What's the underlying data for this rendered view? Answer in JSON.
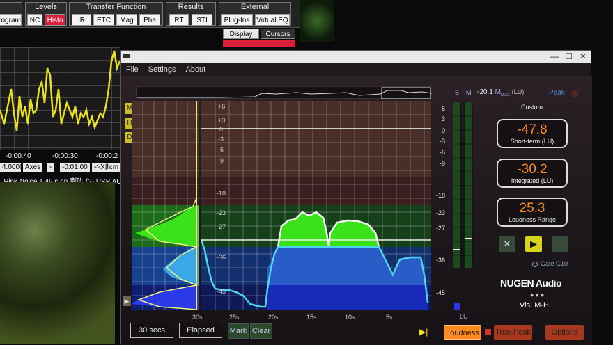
{
  "background_app": {
    "toolbar_groups": [
      {
        "title": "",
        "buttons": [
          "rogram"
        ]
      },
      {
        "title": "Levels",
        "buttons": [
          "NC",
          "Histo"
        ]
      },
      {
        "title": "Transfer Function",
        "buttons": [
          "IR",
          "ETC",
          "Mag",
          "Pha"
        ]
      },
      {
        "title": "Results",
        "buttons": [
          "RT",
          "STI"
        ]
      },
      {
        "title": "External",
        "buttons": [
          "Plug-Ins",
          "Virtual EQ"
        ]
      }
    ],
    "active_button": "Histo",
    "tabs": [
      "Display",
      "Cursors"
    ],
    "time_ticks": [
      "-0:00:40",
      "-0:00:30",
      "-0:00:2"
    ],
    "controls": [
      "4.0000",
      "Axes",
      "-",
      "-0:01:00",
      "<-X|h:m"
    ],
    "status": ": Pink Noise   1.49 s on 喇叭 (2- USB AUD"
  },
  "app": {
    "title_controls": {
      "minimize": "—",
      "maximize": "☐",
      "close": "✕"
    },
    "menu": [
      "File",
      "Settings",
      "About"
    ],
    "side_buttons": [
      "M",
      "H",
      "D"
    ],
    "db_scale": [
      "+6",
      "+3",
      "0",
      "-3",
      "-6",
      "-9",
      "-18",
      "-23",
      "-27",
      "-36",
      "-45"
    ],
    "time_axis": [
      "30s",
      "25s",
      "20s",
      "15s",
      "10s",
      "5s"
    ],
    "footer": {
      "window": "30 secs",
      "mode": "Elapsed",
      "mark": "Mark",
      "clear": "Clear"
    },
    "meter": {
      "sm_labels": [
        "S",
        "M"
      ],
      "scale": [
        "6",
        "3",
        "0",
        "-3",
        "-6",
        "-9",
        "-18",
        "-23",
        "-27",
        "-36",
        "-45"
      ],
      "lu_label": "LU",
      "max_value": "-20.1",
      "max_label": "M",
      "max_sub": "MAX",
      "max_unit": "(LU)",
      "peak_label": "Peak",
      "preset": "Custom",
      "short_term": {
        "value": "-47.8",
        "label": "Short-term (LU)"
      },
      "integrated": {
        "value": "-30.2",
        "label": "Integrated (LU)"
      },
      "range": {
        "value": "25.3",
        "label": "Loudness Range"
      },
      "gate": "Gate G10",
      "brand": "NUGEN Audio",
      "product": "VisLM-H",
      "transport": {
        "stop": "✕",
        "play": "▶",
        "pause": "II"
      }
    },
    "bottom_buttons": {
      "loudness": "Loudness",
      "true_peak": "True-Peak",
      "options": "Options",
      "skip": "▶|"
    },
    "colors": {
      "accent": "#ff8a1e",
      "green": "#39c21d",
      "blue": "#2a5cc8",
      "cyan": "#4fd4f0",
      "yellow": "#d8d21e"
    }
  }
}
